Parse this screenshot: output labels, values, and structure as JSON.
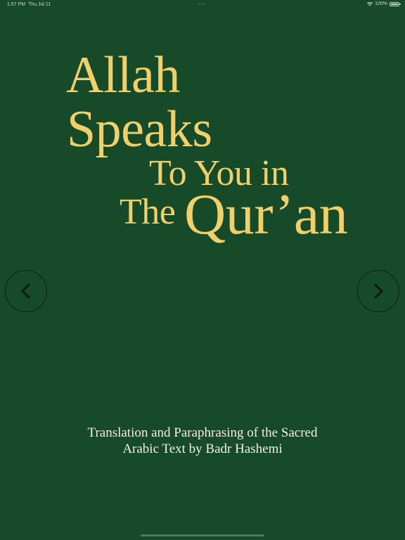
{
  "status_bar": {
    "time": "1:57 PM",
    "date": "Thu Jul 11",
    "dots": "···",
    "battery": "100%"
  },
  "cover": {
    "line_allah": "Allah",
    "line_speaks": "Speaks",
    "line_to_you_in": "To You in",
    "line_the": "The",
    "line_quran": "Qur’an"
  },
  "navigation": {
    "previous_icon": "chevron-left-icon",
    "next_icon": "chevron-right-icon"
  },
  "subtitle": {
    "line1": "Translation and Paraphrasing of the Sacred",
    "line2": "Arabic Text by Badr Hashemi"
  },
  "colors": {
    "background": "#174a28",
    "title": "#f1cf6a",
    "subtitle": "#f3efe2",
    "button_border": "#0b2214"
  }
}
